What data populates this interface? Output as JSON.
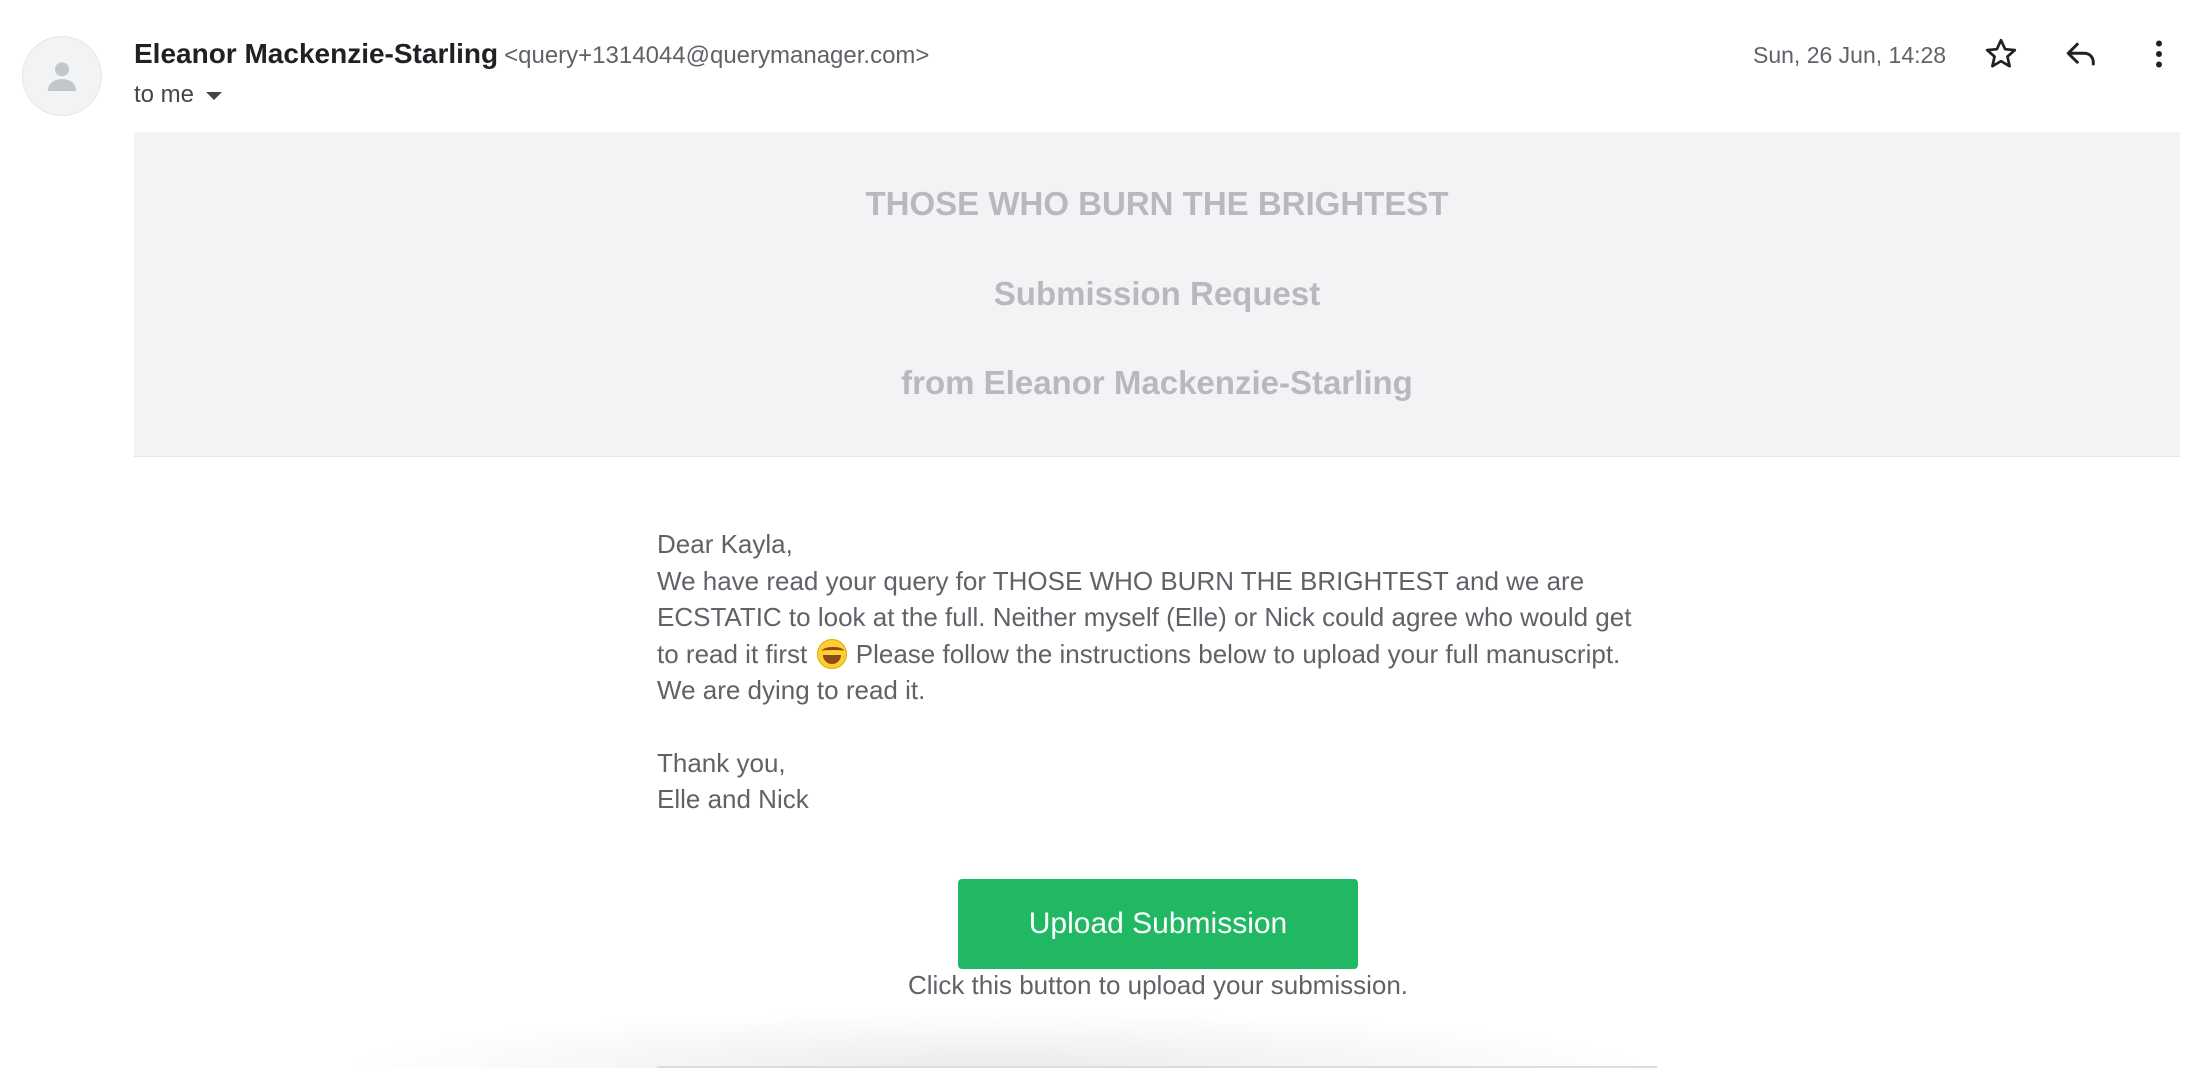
{
  "header": {
    "sender_name": "Eleanor Mackenzie-Starling",
    "sender_email": "<query+1314044@querymanager.com>",
    "recipient_label": "to me",
    "date": "Sun, 26 Jun, 14:28",
    "icons": {
      "avatar": "person-icon",
      "star": "star-icon",
      "reply": "reply-icon",
      "more": "more-vertical-icon",
      "recipients": "caret-down-icon"
    }
  },
  "banner": {
    "title": "THOSE WHO BURN THE BRIGHTEST",
    "subtitle": "Submission Request",
    "from": "from Eleanor Mackenzie-Starling"
  },
  "letter": {
    "greeting": "Dear Kayla,",
    "line1": "We have read your query for THOSE WHO BURN THE BRIGHTEST and we are",
    "line2": "ECSTATIC to look at the full. Neither myself (Elle) or Nick could agree who would get",
    "line3_start": "to read it first",
    "emoji": "laughing-emoji",
    "line3_end": "Please follow the instructions below to upload your full manuscript.",
    "line4": "We are dying to read it.",
    "closing": "Thank you,",
    "signature": "Elle and Nick"
  },
  "action": {
    "button_label": "Upload Submission",
    "helper_text": "Click this button to upload your submission."
  },
  "colors": {
    "button": "#21b864",
    "banner_bg": "#f2f3f5",
    "banner_text": "#b7b9bc",
    "body_text": "#5f6368"
  }
}
